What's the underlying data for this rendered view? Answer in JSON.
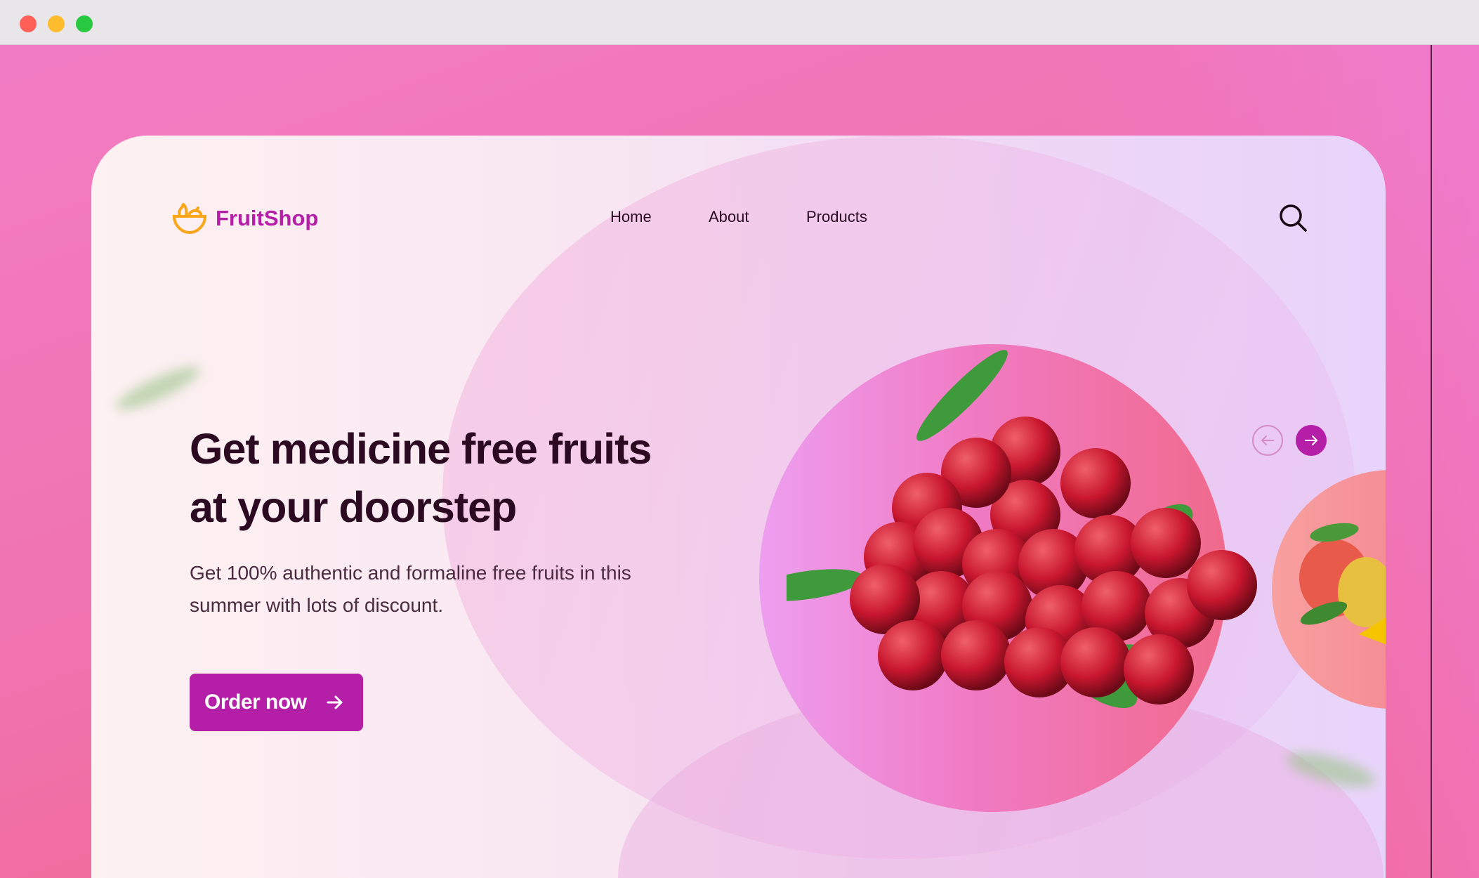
{
  "window": {
    "controls": [
      "close",
      "minimize",
      "maximize"
    ]
  },
  "brand": {
    "name": "FruitShop",
    "icon": "fruit-basket-icon",
    "color": "#b51ea7"
  },
  "nav": {
    "items": [
      "Home",
      "About",
      "Products"
    ],
    "search_icon": "search-icon"
  },
  "hero": {
    "title_line1": "Get medicine free fruits",
    "title_line2": "at your doorstep",
    "subtitle": "Get 100% authentic and formaline free fruits in this summer with lots of discount.",
    "cta_label": "Order now"
  },
  "carousel": {
    "prev_icon": "arrow-left-icon",
    "next_icon": "arrow-right-icon",
    "current_image": "cranberries",
    "next_image": "mango"
  },
  "colors": {
    "accent": "#b51ea7",
    "logo_icon": "#f9a61a",
    "heading": "#2c0a22"
  }
}
